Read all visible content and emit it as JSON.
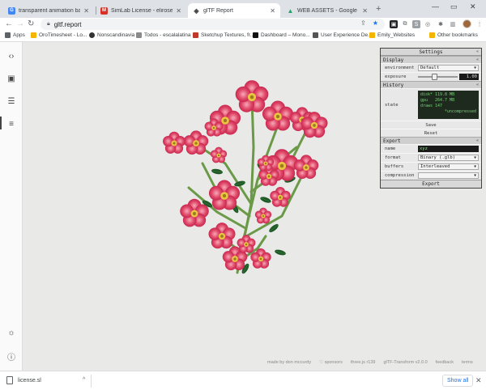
{
  "tabs": [
    {
      "title": "transparent animation backgrou",
      "fav_color": "#4285f4",
      "fav_glyph": "G"
    },
    {
      "title": "SimLab License - elirosenwasser",
      "fav_color": "#d93025",
      "fav_glyph": "M"
    },
    {
      "title": "glTF Report",
      "fav_color": "#444444",
      "fav_glyph": ""
    },
    {
      "title": "WEB ASSETS - Google Drive",
      "fav_color": "#1fa463",
      "fav_glyph": "▲"
    }
  ],
  "url": "gltf.report",
  "bookmarks": [
    {
      "label": "Apps",
      "color": "#5f6368"
    },
    {
      "label": "OroTimesheet - Lo...",
      "color": "#f4b400"
    },
    {
      "label": "Nonscandinavia",
      "color": "#333333"
    },
    {
      "label": "Todos - escalalatina",
      "color": "#8a8a8a"
    },
    {
      "label": "Sketchup Textures, fr...",
      "color": "#c0392b"
    },
    {
      "label": "Dashboard – Mono...",
      "color": "#111111"
    },
    {
      "label": "User Experience De...",
      "color": "#555555"
    },
    {
      "label": "Emily_Websites",
      "color": "#f4b400"
    },
    {
      "label": "Other bookmarks",
      "color": "#f4b400"
    }
  ],
  "panel": {
    "title": "Settings",
    "display": {
      "header": "Display",
      "env_label": "environment",
      "env_value": "Default",
      "exposure_label": "exposure",
      "exposure_value": "1.00",
      "exposure_fraction": 0.4
    },
    "history": {
      "header": "History",
      "state_label": "state",
      "rows": [
        {
          "k": "disk*",
          "v": "119.8 MB"
        },
        {
          "k": "gpu",
          "v": "264.7 MB"
        },
        {
          "k": "draws",
          "v": "147"
        }
      ],
      "note": "*uncompressed",
      "save": "Save",
      "reset": "Reset"
    },
    "export": {
      "header": "Export",
      "name_label": "name",
      "name_value": "xyz",
      "format_label": "format",
      "format_value": "Binary (.glb)",
      "buffers_label": "buffers",
      "buffers_value": "Interleaved",
      "compression_label": "compression",
      "compression_value": "",
      "button": "Export"
    }
  },
  "footer": [
    "made by don mccurdy",
    "♡ sponsors",
    "three.js r139",
    "glTF-Transform v2.0.0",
    "feedback",
    "terms"
  ],
  "download": {
    "file": "license.sl",
    "show_all": "Show all"
  }
}
